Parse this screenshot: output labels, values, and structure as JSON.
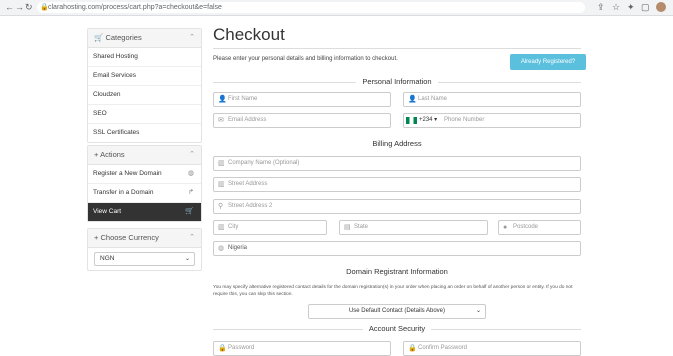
{
  "browser": {
    "url": "clarahosting.com/process/cart.php?a=checkout&e=false",
    "icons": [
      "back-icon",
      "forward-icon",
      "reload-icon",
      "share-icon",
      "star-icon",
      "extensions-icon",
      "window-icon"
    ]
  },
  "sidebar": {
    "categories": {
      "heading": "Categories",
      "items": [
        "Shared Hosting",
        "Email Services",
        "Cloudzen",
        "SEO",
        "SSL Certificates"
      ]
    },
    "actions": {
      "heading": "Actions",
      "items": [
        {
          "label": "Register a New Domain",
          "icon": "globe-icon"
        },
        {
          "label": "Transfer in a Domain",
          "icon": "share-arrow-icon"
        },
        {
          "label": "View Cart",
          "icon": "cart-icon",
          "active": true
        }
      ]
    },
    "currency": {
      "heading": "Choose Currency",
      "selected": "NGN"
    }
  },
  "main": {
    "title": "Checkout",
    "intro": "Please enter your personal details and billing information to checkout.",
    "already_registered": "Already Registered?",
    "personal_heading": "Personal Information",
    "first_name": "First Name",
    "last_name": "Last Name",
    "email": "Email Address",
    "phone_code": "+234",
    "phone": "Phone Number",
    "billing_heading": "Billing Address",
    "company": "Company Name (Optional)",
    "street": "Street Address",
    "street2": "Street Address 2",
    "city": "City",
    "state": "State",
    "postcode": "Postcode",
    "country": "Nigeria",
    "domain_heading": "Domain Registrant Information",
    "domain_notice": "You may specify alternative registered contact details for the domain registration(s) in your order when placing an order on behalf of another person or entity. If you do not require this, you can skip this section.",
    "contact_select": "Use Default Contact (Details Above)",
    "security_heading": "Account Security",
    "password": "Password",
    "confirm_password": "Confirm Password"
  },
  "colors": {
    "accent": "#5bc0de",
    "active_item": "#333333",
    "phone_flag": "#008751"
  }
}
